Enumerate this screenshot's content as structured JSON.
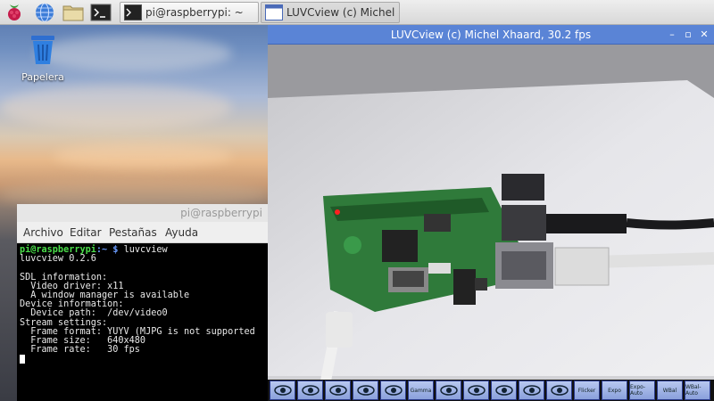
{
  "taskbar": {
    "tasks": [
      {
        "label": "pi@raspberrypi: ~"
      },
      {
        "label": "LUVCview (c) Michel ..."
      }
    ]
  },
  "desktop": {
    "trash_label": "Papelera"
  },
  "terminal": {
    "title": "pi@raspberrypi",
    "menu": [
      "Archivo",
      "Editar",
      "Pestañas",
      "Ayuda"
    ],
    "prompt_user": "pi@raspberrypi",
    "prompt_path": "~",
    "command": "luvcview",
    "output": [
      "luvcview 0.2.6",
      "",
      "SDL information:",
      "  Video driver: x11",
      "  A window manager is available",
      "Device information:",
      "  Device path:  /dev/video0",
      "Stream settings:",
      "  Frame format: YUYV (MJPG is not supported",
      "  Frame size:   640x480",
      "  Frame rate:   30 fps"
    ]
  },
  "luvcview": {
    "title": "LUVCview (c) Michel Xhaard, 30.2 fps",
    "minimize_glyph": "–",
    "maximize_glyph": "▫",
    "close_glyph": "✕",
    "toolbar_buttons": [
      {
        "label": ""
      },
      {
        "label": ""
      },
      {
        "label": ""
      },
      {
        "label": ""
      },
      {
        "label": ""
      },
      {
        "label": "Gamma"
      },
      {
        "label": ""
      },
      {
        "label": ""
      },
      {
        "label": ""
      },
      {
        "label": ""
      },
      {
        "label": ""
      },
      {
        "label": "Flicker"
      },
      {
        "label": "Expo"
      },
      {
        "label": "Expo-Auto"
      },
      {
        "label": "WBal"
      },
      {
        "label": "WBal-Auto"
      }
    ]
  }
}
